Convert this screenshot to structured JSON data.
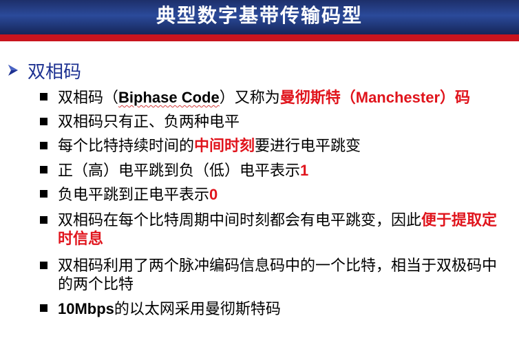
{
  "title": "典型数字基带传输码型",
  "section": {
    "label": "双相码",
    "icon": "arrow-right-icon"
  },
  "bullets": [
    {
      "parts": [
        {
          "text": "双相码（",
          "style": "normal"
        },
        {
          "text": "Biphase Code",
          "style": "latin"
        },
        {
          "text": "）又称为",
          "style": "normal"
        },
        {
          "text": "曼彻斯特（",
          "style": "red"
        },
        {
          "text": "Manchester",
          "style": "red"
        },
        {
          "text": "）码",
          "style": "red"
        }
      ]
    },
    {
      "parts": [
        {
          "text": "双相码只有正、负两种电平",
          "style": "normal"
        }
      ]
    },
    {
      "parts": [
        {
          "text": "每个比特持续时间的",
          "style": "normal"
        },
        {
          "text": "中间时刻",
          "style": "red"
        },
        {
          "text": "要进行电平跳变",
          "style": "normal"
        }
      ]
    },
    {
      "parts": [
        {
          "text": "正（高）电平跳到负（低）电平表示",
          "style": "normal"
        },
        {
          "text": "1",
          "style": "red"
        }
      ]
    },
    {
      "parts": [
        {
          "text": "负电平跳到正电平表示",
          "style": "normal"
        },
        {
          "text": "0",
          "style": "red"
        }
      ]
    },
    {
      "parts": [
        {
          "text": "双相码在每个比特周期中间时刻都会有电平跳变，因此",
          "style": "normal"
        },
        {
          "text": "便于提取定时信息",
          "style": "red"
        }
      ]
    },
    {
      "parts": [
        {
          "text": "双相码利用了两个脉冲编码信息码中的一个比特，相当于双极码中的两个比特",
          "style": "normal"
        }
      ]
    },
    {
      "parts": [
        {
          "text": "10Mbps",
          "style": "latin"
        },
        {
          "text": "的以太网采用曼彻斯特码",
          "style": "normal"
        }
      ]
    }
  ],
  "colors": {
    "header_blue": "#2b4a9a",
    "accent_red": "#e0141c",
    "heading_blue": "#1d3191"
  }
}
